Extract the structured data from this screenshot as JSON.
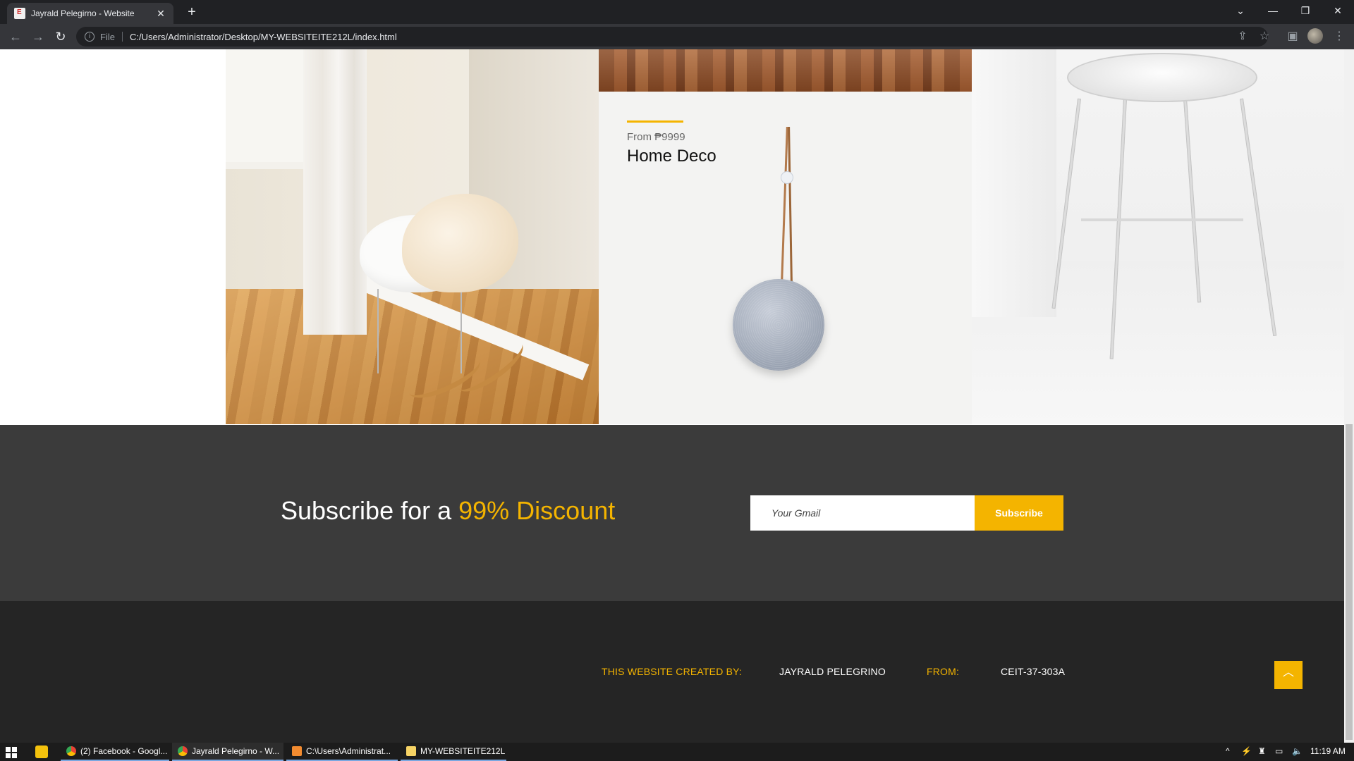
{
  "browser": {
    "tab_title": "Jayrald Pelegirno - Website",
    "address": "C:/Users/Administrator/Desktop/MY-WEBSITEITE212L/index.html",
    "file_label": "File"
  },
  "gallery": {
    "deco_price": "From ₱9999",
    "deco_title": "Home Deco"
  },
  "subscribe": {
    "heading_prefix": "Subscribe for a ",
    "heading_highlight": "99% Discount",
    "input_placeholder": "Your Gmail",
    "button_label": "Subscribe"
  },
  "footer": {
    "created_by_label": "THIS WEBSITE CREATED BY:",
    "author": "JAYRALD PELEGRINO",
    "from_label": "FROM:",
    "section": "CEIT-37-303A",
    "to_top_icon": "chevron-up-icon"
  },
  "taskbar": {
    "items": [
      "(2) Facebook - Googl...",
      "Jayrald Pelegirno - W...",
      "C:\\Users\\Administrat...",
      "MY-WEBSITEITE212L"
    ],
    "time": "11:19 AM"
  },
  "colors": {
    "accent": "#f4b400",
    "subscribe_bg": "#3b3b3b",
    "footer_bg": "#252525"
  }
}
